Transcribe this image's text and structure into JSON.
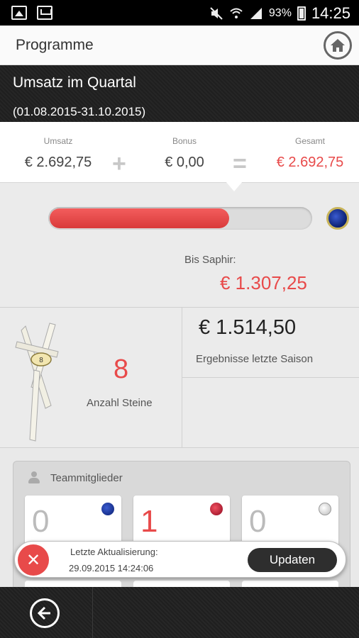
{
  "statusbar": {
    "battery": "93%",
    "time": "14:25",
    "icons": [
      "image-icon",
      "message-icon",
      "mute-icon",
      "wifi-icon",
      "signal-icon",
      "battery-icon"
    ]
  },
  "appbar": {
    "title": "Programme",
    "home_icon": "home-icon"
  },
  "quarter": {
    "title": "Umsatz im Quartal",
    "period": "(01.08.2015-31.10.2015)"
  },
  "summary": {
    "umsatz_label": "Umsatz",
    "umsatz_value": "€ 2.692,75",
    "plus": "+",
    "bonus_label": "Bonus",
    "bonus_value": "€ 0,00",
    "equals": "=",
    "gesamt_label": "Gesamt",
    "gesamt_value": "€ 2.692,75"
  },
  "progress": {
    "fraction": 0.69,
    "label": "Bis Saphir:",
    "remaining": "€ 1.307,25",
    "gem_icon": "sapphire-icon"
  },
  "stats": {
    "steine_count": "8",
    "steine_label": "Anzahl Steine",
    "ribbon_badge": "8",
    "last_season_value": "€ 1.514,50",
    "last_season_label": "Ergebnisse letzte Saison"
  },
  "team": {
    "title": "Teammitglieder",
    "cards": [
      {
        "count": "0",
        "gem": "sapphire-icon"
      },
      {
        "count": "1",
        "gem": "ruby-icon"
      },
      {
        "count": "0",
        "gem": "diamond-icon"
      }
    ]
  },
  "toast": {
    "line1": "Letzte Aktualisierung:",
    "line2": "29.09.2015 14:24:06",
    "button": "Updaten"
  },
  "colors": {
    "accent_red": "#e84a4a",
    "dark": "#262626"
  }
}
